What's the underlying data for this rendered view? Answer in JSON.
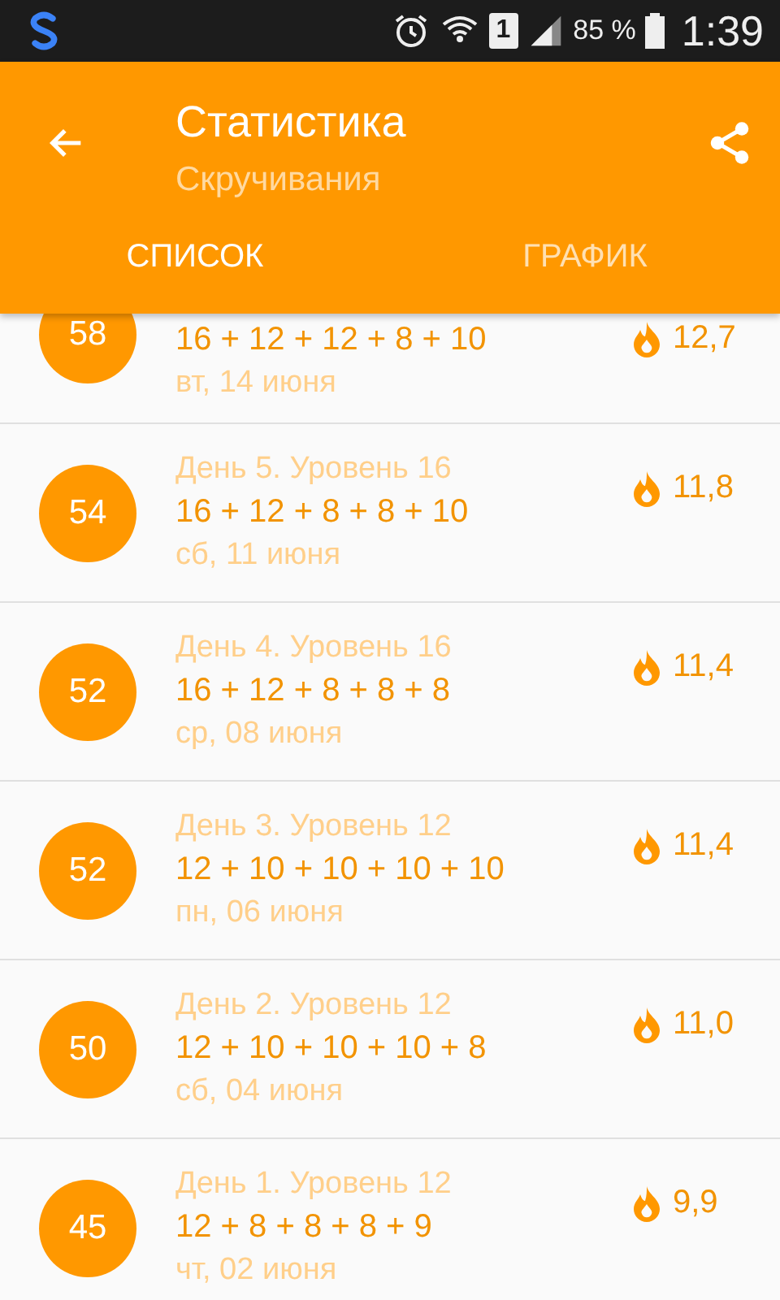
{
  "status_bar": {
    "sim": "1",
    "battery": "85 %",
    "time": "1:39"
  },
  "toolbar": {
    "title": "Статистика",
    "subtitle": "Скручивания"
  },
  "tabs": [
    {
      "label": "СПИСОК",
      "selected": true
    },
    {
      "label": "ГРАФИК",
      "selected": false
    }
  ],
  "records": [
    {
      "total": "58",
      "reps": "16 + 12 + 12 + 8 + 10",
      "date": "вт, 14 июня",
      "calories": "12,7"
    },
    {
      "total": "54",
      "title": "День 5.  Уровень 16",
      "reps": "16 + 12 + 8 + 8 + 10",
      "date": "сб, 11 июня",
      "calories": "11,8"
    },
    {
      "total": "52",
      "title": "День 4.  Уровень 16",
      "reps": "16 + 12 + 8 + 8 + 8",
      "date": "ср, 08 июня",
      "calories": "11,4"
    },
    {
      "total": "52",
      "title": "День 3.  Уровень 12",
      "reps": "12 + 10 + 10 + 10 + 10",
      "date": "пн, 06 июня",
      "calories": "11,4"
    },
    {
      "total": "50",
      "title": "День 2.  Уровень 12",
      "reps": "12 + 10 + 10 + 10 + 8",
      "date": "сб, 04 июня",
      "calories": "11,0"
    },
    {
      "total": "45",
      "title": "День 1.  Уровень 12",
      "reps": "12 + 8 + 8 + 8 + 9",
      "date": "чт, 02 июня",
      "calories": "9,9"
    }
  ]
}
